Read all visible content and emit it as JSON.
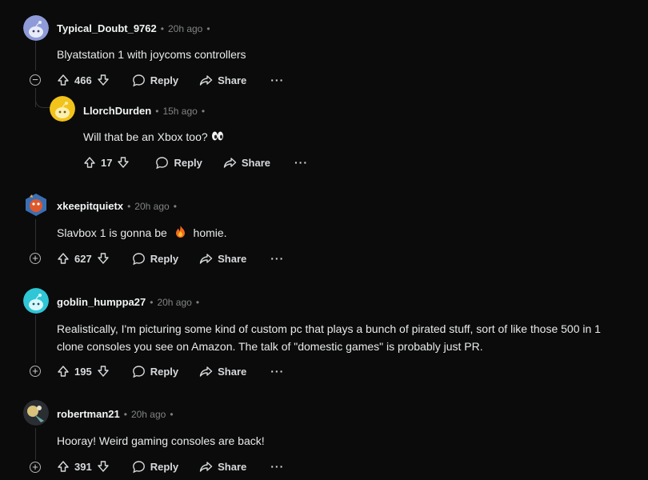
{
  "actions": {
    "reply": "Reply",
    "share": "Share",
    "more": "···"
  },
  "comments": [
    {
      "user": "Typical_Doubt_9762",
      "time": "20h ago",
      "dot": "•",
      "trail": "•",
      "body": "Blyatstation 1 with joycoms controllers",
      "votes": "466"
    },
    {
      "user": "LlorchDurden",
      "time": "15h ago",
      "dot": "•",
      "trail": "•",
      "body": "Will that be an Xbox too?",
      "votes": "17"
    },
    {
      "user": "xkeepitquietx",
      "time": "20h ago",
      "dot": "•",
      "trail": "•",
      "body_before": "Slavbox 1 is gonna be",
      "body_after": "homie.",
      "votes": "627"
    },
    {
      "user": "goblin_humppa27",
      "time": "20h ago",
      "dot": "•",
      "trail": "•",
      "body_line1": "Realistically, I'm picturing some kind of custom pc that plays a bunch of pirated stuff, sort of like those 500 in 1",
      "body_line2": "clone consoles you see on Amazon. The talk of \"domestic games\" is probably just PR.",
      "votes": "195"
    },
    {
      "user": "robertman21",
      "time": "20h ago",
      "dot": "•",
      "trail": "•",
      "body": "Hooray! Weird gaming consoles are back!",
      "votes": "391"
    }
  ],
  "colors": {
    "background": "#0b0b0b",
    "text": "#d7dadc",
    "muted": "#818384"
  }
}
